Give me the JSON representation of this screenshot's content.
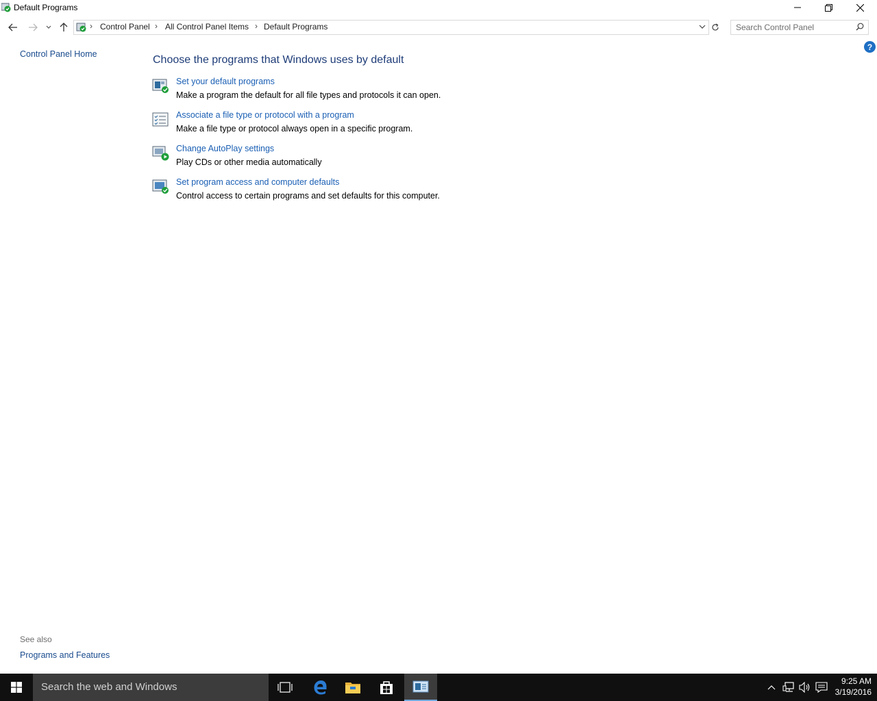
{
  "window": {
    "title": "Default Programs"
  },
  "address": {
    "crumbs": [
      "Control Panel",
      "All Control Panel Items",
      "Default Programs"
    ]
  },
  "search": {
    "placeholder": "Search Control Panel"
  },
  "left_pane": {
    "home_link": "Control Panel Home",
    "see_also_label": "See also",
    "see_also_link": "Programs and Features"
  },
  "main": {
    "heading": "Choose the programs that Windows uses by default",
    "tasks": [
      {
        "link": "Set your default programs",
        "desc": "Make a program the default for all file types and protocols it can open.",
        "icon": "default-programs-icon"
      },
      {
        "link": "Associate a file type or protocol with a program",
        "desc": "Make a file type or protocol always open in a specific program.",
        "icon": "file-association-icon"
      },
      {
        "link": "Change AutoPlay settings",
        "desc": "Play CDs or other media automatically",
        "icon": "autoplay-icon"
      },
      {
        "link": "Set program access and computer defaults",
        "desc": "Control access to certain programs and set defaults for this computer.",
        "icon": "program-access-icon"
      }
    ]
  },
  "taskbar": {
    "search_text": "Search the web and Windows",
    "time": "9:25 AM",
    "date": "3/19/2016"
  },
  "colors": {
    "link": "#1a5fb4",
    "heading": "#1e3c78",
    "taskbar": "#101010"
  }
}
